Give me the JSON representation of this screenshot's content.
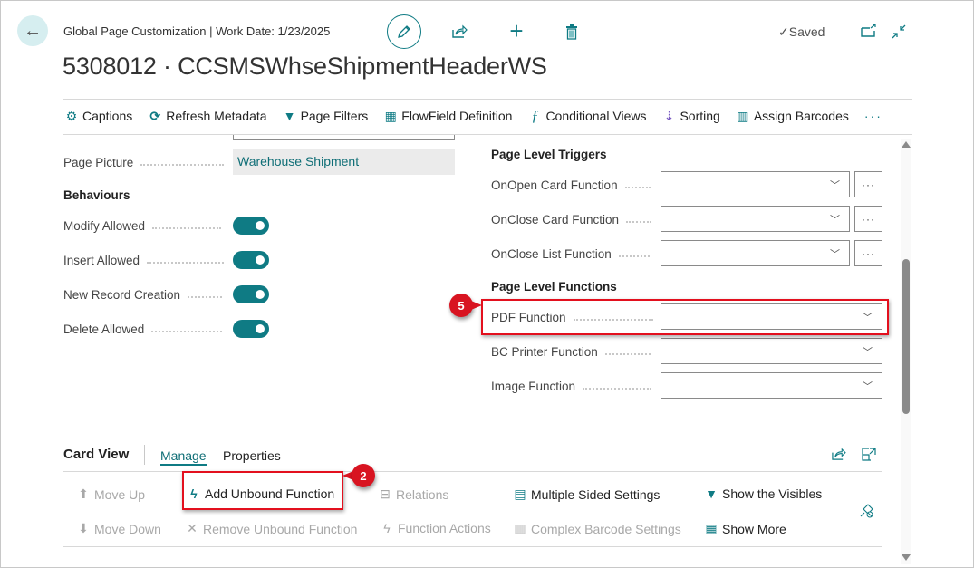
{
  "header": {
    "breadcrumb": "Global Page Customization | Work Date: 1/23/2025",
    "title": "5308012 · CCSMSWhseShipmentHeaderWS",
    "saved_label": "Saved"
  },
  "actionbar": [
    {
      "label": "Captions",
      "icon": "captions-icon",
      "glyph": "⚙"
    },
    {
      "label": "Refresh Metadata",
      "icon": "refresh-icon",
      "glyph": "⟳"
    },
    {
      "label": "Page Filters",
      "icon": "filter-edit-icon",
      "glyph": "▼"
    },
    {
      "label": "FlowField Definition",
      "icon": "flowfield-icon",
      "glyph": "▦"
    },
    {
      "label": "Conditional Views",
      "icon": "function-icon",
      "glyph": "ƒ"
    },
    {
      "label": "Sorting",
      "icon": "sort-az-icon",
      "glyph": "⇣"
    },
    {
      "label": "Assign Barcodes",
      "icon": "barcode-icon",
      "glyph": "▥"
    }
  ],
  "left": {
    "page_picture_label": "Page Picture",
    "page_picture_value": "Warehouse Shipment",
    "behaviours_title": "Behaviours",
    "toggles": [
      {
        "label": "Modify Allowed",
        "on": true
      },
      {
        "label": "Insert Allowed",
        "on": true
      },
      {
        "label": "New Record Creation",
        "on": true
      },
      {
        "label": "Delete Allowed",
        "on": true
      }
    ]
  },
  "right": {
    "triggers_title": "Page Level Triggers",
    "triggers": [
      {
        "label": "OnOpen Card Function",
        "value": ""
      },
      {
        "label": "OnClose Card Function",
        "value": ""
      },
      {
        "label": "OnClose List Function",
        "value": ""
      }
    ],
    "functions_title": "Page Level Functions",
    "functions": [
      {
        "label": "PDF Function",
        "value": ""
      },
      {
        "label": "BC Printer Function",
        "value": ""
      },
      {
        "label": "Image Function",
        "value": ""
      }
    ]
  },
  "cardview": {
    "title": "Card View",
    "tabs": [
      {
        "label": "Manage",
        "active": true
      },
      {
        "label": "Properties",
        "active": false
      }
    ],
    "commands": [
      {
        "label": "Move Up",
        "enabled": false,
        "glyph": "🡅"
      },
      {
        "label": "Move Down",
        "enabled": false,
        "glyph": "🡇"
      },
      {
        "label": "Add Unbound Function",
        "enabled": true,
        "glyph": "ϟ"
      },
      {
        "label": "Remove Unbound Function",
        "enabled": false,
        "glyph": "✕"
      },
      {
        "label": "Relations",
        "enabled": false,
        "glyph": "⊟"
      },
      {
        "label": "Function Actions",
        "enabled": false,
        "glyph": "ϟ"
      },
      {
        "label": "Multiple Sided Settings",
        "enabled": true,
        "glyph": "▤"
      },
      {
        "label": "Complex Barcode Settings",
        "enabled": false,
        "glyph": "▥"
      },
      {
        "label": "Show the Visibles",
        "enabled": true,
        "glyph": "▼"
      },
      {
        "label": "Show More",
        "enabled": true,
        "glyph": "▦"
      }
    ]
  },
  "annotations": [
    {
      "number": "5"
    },
    {
      "number": "2"
    }
  ],
  "colors": {
    "accent": "#0f7b84",
    "annotation": "#e3101e"
  }
}
